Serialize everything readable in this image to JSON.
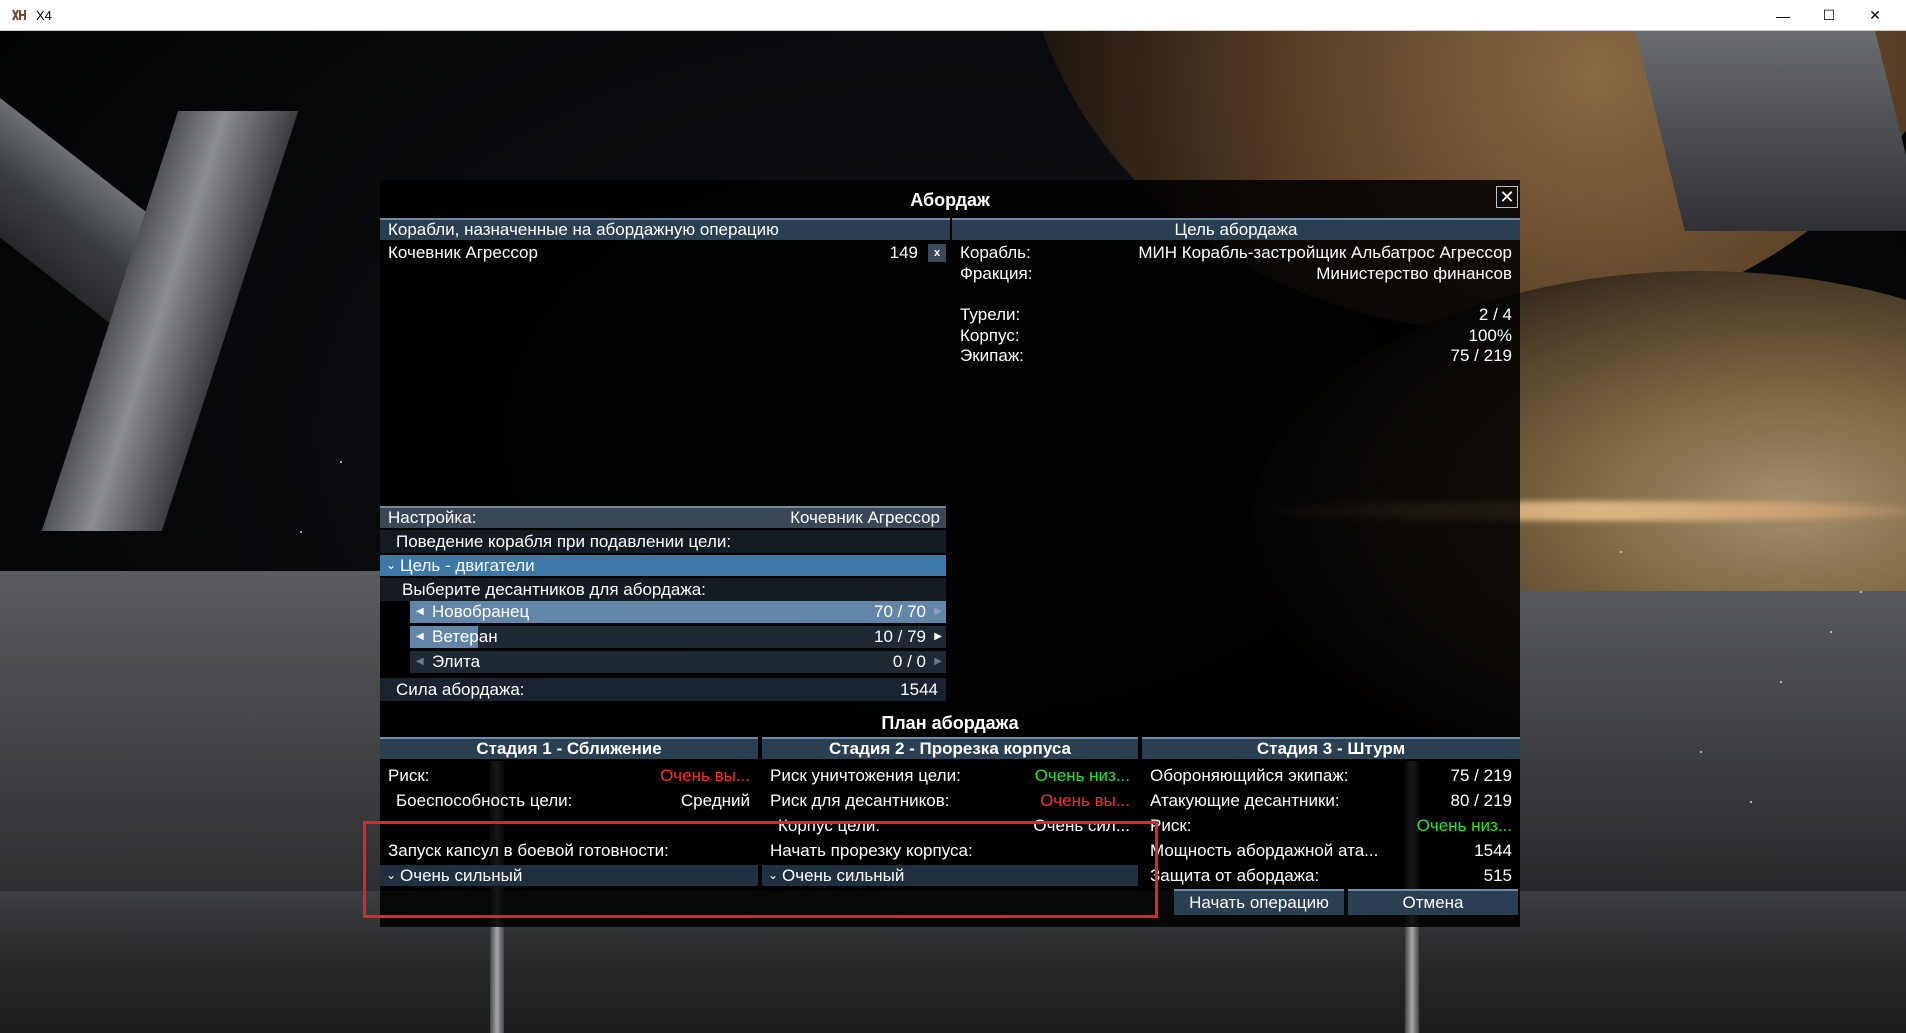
{
  "window": {
    "title": "X4"
  },
  "dialog": {
    "title": "Абордаж",
    "assigned_header": "Корабли, назначенные на абордажную операцию",
    "assigned_ships": [
      {
        "name": "Кочевник Агрессор",
        "count": "149",
        "remove": "x"
      }
    ],
    "target_header": "Цель абордажа",
    "target": {
      "ship_label": "Корабль:",
      "ship_value": "МИН Корабль-застройщик Альбатрос Агрессор",
      "faction_label": "Фракция:",
      "faction_value": "Министерство финансов",
      "turrets_label": "Турели:",
      "turrets_value": "2 / 4",
      "hull_label": "Корпус:",
      "hull_value": "100%",
      "crew_label": "Экипаж:",
      "crew_value": "75 / 219"
    },
    "settings": {
      "label": "Настройка:",
      "ship": "Кочевник Агрессор",
      "behavior_label": "Поведение корабля при подавлении цели:",
      "behavior_value": "Цель - двигатели",
      "choose_label": "Выберите десантников для абордажа:",
      "marines": [
        {
          "name": "Новобранец",
          "value": "70 / 70",
          "fraction": 1.0
        },
        {
          "name": "Ветеран",
          "value": "10 / 79",
          "fraction": 0.127
        },
        {
          "name": "Элита",
          "value": "0 / 0",
          "fraction": 0
        }
      ],
      "strength_label": "Сила абордажа:",
      "strength_value": "1544"
    },
    "plan": {
      "title": "План абордажа",
      "stage1": {
        "title": "Стадия 1 - Сближение",
        "risk_label": "Риск:",
        "risk_value": "Очень вы...",
        "combat_label": "Боеспособность цели:",
        "combat_value": "Средний",
        "launch_label": "Запуск капсул в боевой готовности:",
        "launch_value": "Очень сильный"
      },
      "stage2": {
        "title": "Стадия 2 - Прорезка корпуса",
        "destroy_label": "Риск уничтожения цели:",
        "destroy_value": "Очень низ...",
        "marine_risk_label": "Риск для десантников:",
        "marine_risk_value": "Очень вы...",
        "hull_label": "Корпус цели:",
        "hull_value": "Очень сил...",
        "start_label": "Начать прорезку корпуса:",
        "start_value": "Очень сильный"
      },
      "stage3": {
        "title": "Стадия 3 - Штурм",
        "defending_label": "Обороняющийся экипаж:",
        "defending_value": "75 / 219",
        "attacking_label": "Атакующие десантники:",
        "attacking_value": "80 / 219",
        "risk_label": "Риск:",
        "risk_value": "Очень низ...",
        "power_label": "Мощность абордажной ата...",
        "power_value": "1544",
        "defense_label": "Защита от абордажа:",
        "defense_value": "515"
      }
    },
    "buttons": {
      "start": "Начать операцию",
      "cancel": "Отмена"
    }
  },
  "colors": {
    "accent": "#3d78a8",
    "risk_high": "#ff2a2a",
    "risk_low": "#2be02b",
    "highlight": "#e0242a"
  }
}
